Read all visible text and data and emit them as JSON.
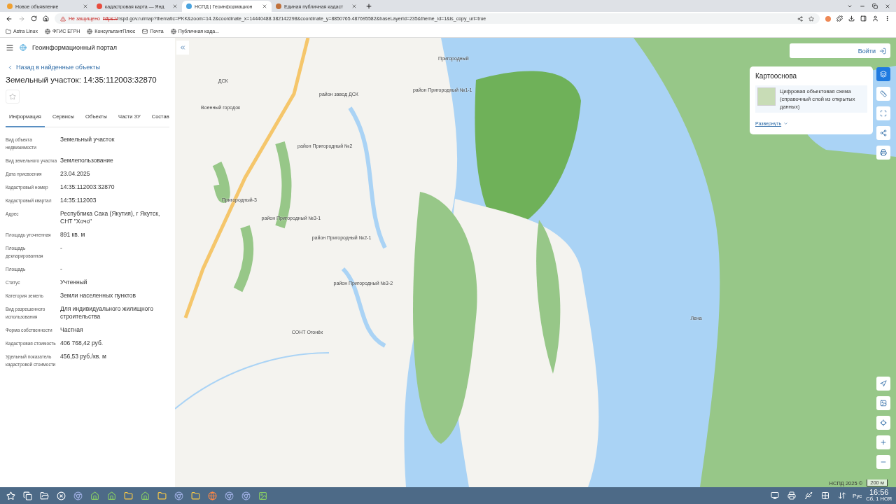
{
  "browser": {
    "tabs": [
      {
        "title": "Новое объявление",
        "selected": false
      },
      {
        "title": "кадастровая карта — Янд",
        "selected": false
      },
      {
        "title": "НСПД | Геоинформацион",
        "selected": true
      },
      {
        "title": "Единая публичная кадаст",
        "selected": false
      }
    ],
    "security": "Не защищено",
    "url_scheme": "https://",
    "url": "nspd.gov.ru/map?thematic=PKK&zoom=14.2&coordinate_x=14440488.382142298&coordinate_y=8850765.487695582&baseLayerId=235&theme_id=1&is_copy_url=true",
    "bookmarks": [
      "Astra Linux",
      "ФГИС ЕГРН",
      "КонсультантПлюс",
      "Почта",
      "Публичная када..."
    ]
  },
  "portal": {
    "title": "Геоинформационный портал",
    "back_link": "Назад в найденные объекты",
    "heading": "Земельный участок: 14:35:112003:32870",
    "tabs": [
      {
        "label": "Информация",
        "selected": true
      },
      {
        "label": "Сервисы",
        "selected": false
      },
      {
        "label": "Объекты",
        "selected": false
      },
      {
        "label": "Части ЗУ",
        "selected": false
      },
      {
        "label": "Состав",
        "selected": false
      }
    ],
    "fields": [
      {
        "label": "Вид объекта недвижимости",
        "value": "Земельный участок"
      },
      {
        "label": "Вид земельного участка",
        "value": "Землепользование"
      },
      {
        "label": "Дата присвоения",
        "value": "23.04.2025"
      },
      {
        "label": "Кадастровый номер",
        "value": "14:35:112003:32870"
      },
      {
        "label": "Кадастровый квартал",
        "value": "14:35:112003"
      },
      {
        "label": "Адрес",
        "value": "Республика Саха (Якутия), г Якутск, СНТ \"Хочо\""
      },
      {
        "label": "Площадь уточненная",
        "value": "891 кв. м"
      },
      {
        "label": "Площадь декларированная",
        "value": "-"
      },
      {
        "label": "Площадь",
        "value": "-"
      },
      {
        "label": "Статус",
        "value": "Учтенный"
      },
      {
        "label": "Категория земель",
        "value": "Земли населенных пунктов"
      },
      {
        "label": "Вид разрешенного использования",
        "value": "Для индивидуального жилищного строительства"
      },
      {
        "label": "Форма собственности",
        "value": "Частная"
      },
      {
        "label": "Кадастровая стоимость",
        "value": "406 768,42 руб."
      },
      {
        "label": "Удельный показатель кадастровой стоимости",
        "value": "456,53 руб./кв. м"
      }
    ]
  },
  "map": {
    "login": "Войти",
    "basemap": {
      "title": "Картооснова",
      "layer": "Цифровая объектовая схема (справочный слой из открытых данных)",
      "expand": "Развернуть"
    },
    "labels": [
      {
        "text": "ДСК"
      },
      {
        "text": "Военный городок"
      },
      {
        "text": "район завод ДСК"
      },
      {
        "text": "Пригородный"
      },
      {
        "text": "район Пригородный №1-1"
      },
      {
        "text": "район Пригородный №2"
      },
      {
        "text": "Пригородный-3"
      },
      {
        "text": "район Пригородный №3-1"
      },
      {
        "text": "район Пригородный №2-1"
      },
      {
        "text": "район Пригородный №3-2"
      },
      {
        "text": "СОНТ Огонёк"
      },
      {
        "text": "Лена"
      }
    ],
    "attribution": "НСПД 2025 ©",
    "scale": "200 м"
  },
  "taskbar": {
    "language": "Рус",
    "time": "16:56",
    "date": "Сб, 1 НОЯ"
  }
}
